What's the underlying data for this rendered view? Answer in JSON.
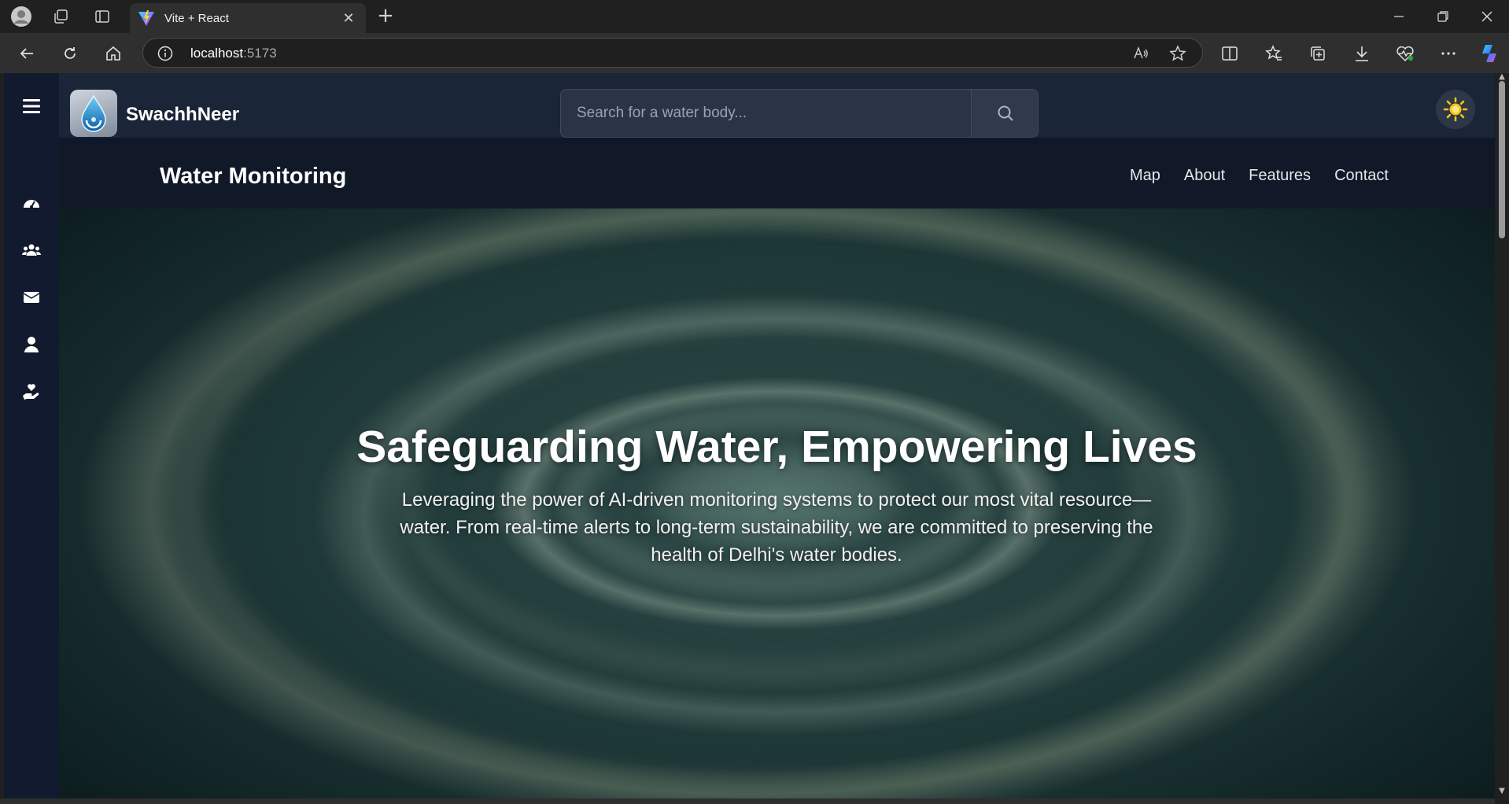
{
  "browser": {
    "tab_title": "Vite + React",
    "url_host": "localhost",
    "url_port": ":5173"
  },
  "app": {
    "brand": "SwachhNeer",
    "search_placeholder": "Search for a water body...",
    "navbar_title": "Water Monitoring",
    "nav_links": [
      "Map",
      "About",
      "Features",
      "Contact"
    ],
    "sidebar_icons": [
      "menu-icon",
      "dashboard-icon",
      "users-icon",
      "mail-icon",
      "user-icon",
      "hand-heart-icon"
    ],
    "hero": {
      "title": "Safeguarding Water, Empowering Lives",
      "subtitle": "Leveraging the power of AI-driven monitoring systems to protect our most vital resource—water. From real-time alerts to long-term sustainability, we are committed to preserving the health of Delhi's water bodies."
    }
  },
  "colors": {
    "sidebar_bg": "#111a2e",
    "header_bg": "#1b2538",
    "navbar_bg": "#111827",
    "sun_icon": "#f5c518"
  }
}
